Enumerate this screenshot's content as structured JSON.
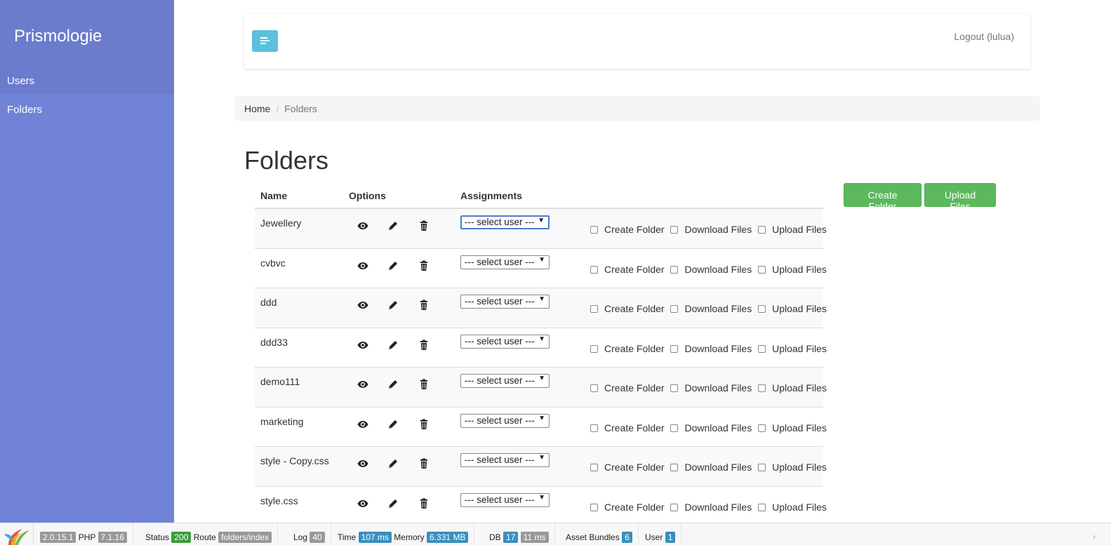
{
  "sidebar": {
    "brand": "Prismologie",
    "items": [
      {
        "label": "Users"
      },
      {
        "label": "Folders"
      }
    ]
  },
  "header": {
    "logout": "Logout (lulua)"
  },
  "breadcrumb": {
    "home": "Home",
    "separator": "/",
    "current": "Folders"
  },
  "page": {
    "title": "Folders"
  },
  "table": {
    "columns": {
      "name": "Name",
      "options": "Options",
      "assignments": "Assignments"
    },
    "select_placeholder": "--- select user ---",
    "permissions": [
      "Create Folder",
      "Download Files",
      "Upload Files"
    ],
    "rows": [
      {
        "name": "Jewellery"
      },
      {
        "name": "cvbvc"
      },
      {
        "name": "ddd"
      },
      {
        "name": "ddd33"
      },
      {
        "name": "demo111"
      },
      {
        "name": "marketing"
      },
      {
        "name": "style - Copy.css"
      },
      {
        "name": "style.css"
      }
    ]
  },
  "actions": {
    "create_folder": "Create Folder",
    "upload_files": "Upload Files"
  },
  "debug": {
    "version": "2.0.15.1",
    "php_label": "PHP",
    "php_version": "7.1.16",
    "status_label": "Status",
    "status_value": "200",
    "route_label": "Route",
    "route_value": "folders/index",
    "log_label": "Log",
    "log_value": "40",
    "time_label": "Time",
    "time_value": "107 ms",
    "memory_label": "Memory",
    "memory_value": "6.331 MB",
    "db_label": "DB",
    "db_count": "17",
    "db_time": "11 ms",
    "bundles_label": "Asset Bundles",
    "bundles_value": "6",
    "user_label": "User",
    "user_value": "1",
    "arrow": "›"
  },
  "colors": {
    "sidebar": "#7083d6",
    "toggle": "#5bc0de",
    "success": "#5cb85c"
  }
}
